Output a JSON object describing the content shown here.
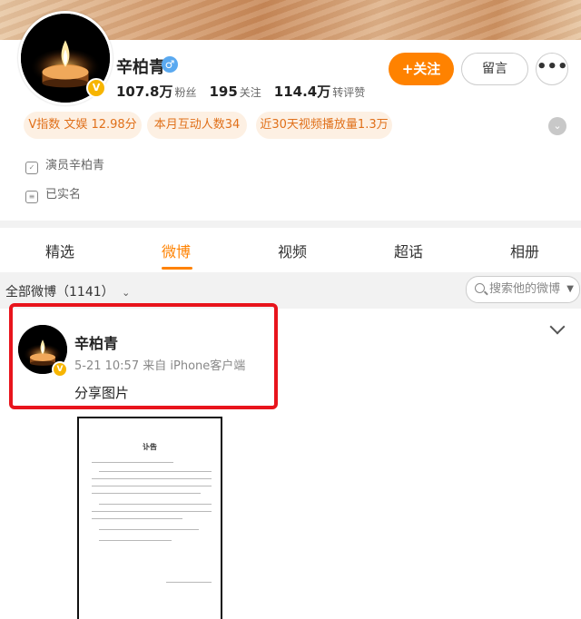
{
  "profile": {
    "name": "辛柏青",
    "gender_icon": "male-icon",
    "followers_num": "107.8万",
    "followers_label": "粉丝",
    "following_num": "195",
    "following_label": "关注",
    "reposts_num": "114.4万",
    "reposts_label": "转评赞",
    "follow_button": "关注",
    "message_button": "留言",
    "more_button": "•••"
  },
  "tags": [
    "V指数 文娱 12.98分",
    "本月互动人数34",
    "近30天视频播放量1.3万"
  ],
  "info": {
    "occupation": "演员辛柏青",
    "verified": "已实名"
  },
  "tabs": [
    "精选",
    "微博",
    "视频",
    "超话",
    "相册"
  ],
  "active_tab": "微博",
  "filter": {
    "label": "全部微博（1141）",
    "search_placeholder": "搜索他的微博"
  },
  "post": {
    "author": "辛柏青",
    "time": "5-21 10:57",
    "source": "来自 iPhone客户端",
    "text": "分享图片",
    "image_title": "讣告"
  },
  "colors": {
    "accent": "#ff8200",
    "tag_bg": "#fdf0e3",
    "tag_text": "#e0701a",
    "highlight_box": "#e8141c",
    "verified_badge": "#f7b500"
  }
}
